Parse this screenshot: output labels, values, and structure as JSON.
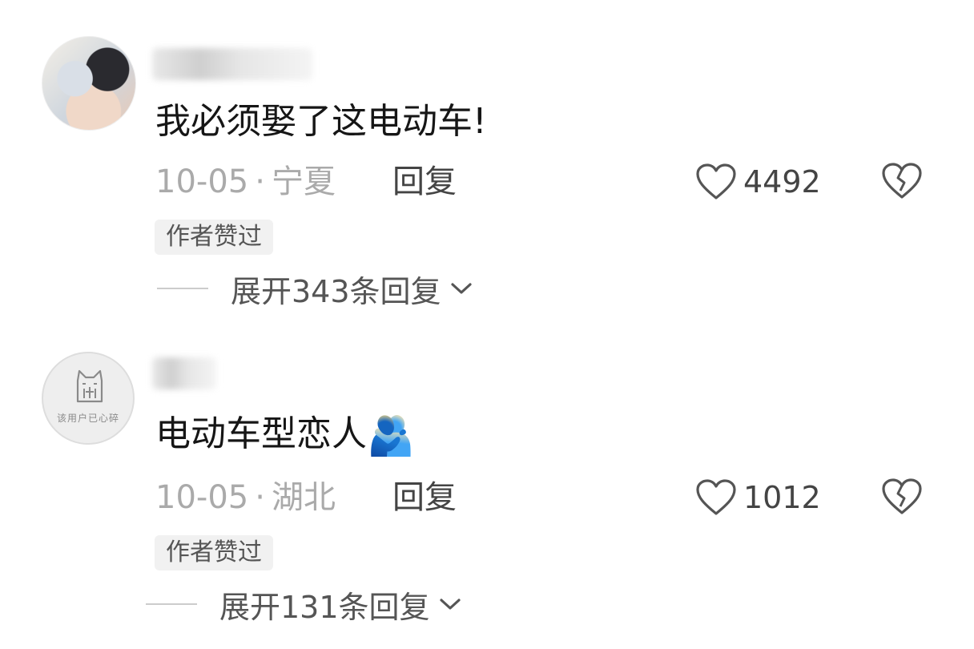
{
  "comments": [
    {
      "content": "我必须娶了这电动车!",
      "emoji": "",
      "date": "10-05",
      "separator": "·",
      "location": "宁夏",
      "reply_label": "回复",
      "likes": "4492",
      "author_badge": "作者赞过",
      "expand_label": "展开343条回复"
    },
    {
      "content": "电动车型恋人",
      "emoji": "🫂",
      "avatar_caption": "该用户已心碎",
      "date": "10-05",
      "separator": "·",
      "location": "湖北",
      "reply_label": "回复",
      "likes": "1012",
      "author_badge": "作者赞过",
      "expand_label": "展开131条回复"
    }
  ],
  "icons": {
    "like": "heart-outline-icon",
    "dislike": "broken-heart-icon",
    "expand": "chevron-down-icon"
  },
  "colors": {
    "text_primary": "#161616",
    "text_meta": "#aaaaaa",
    "text_secondary": "#555555"
  }
}
